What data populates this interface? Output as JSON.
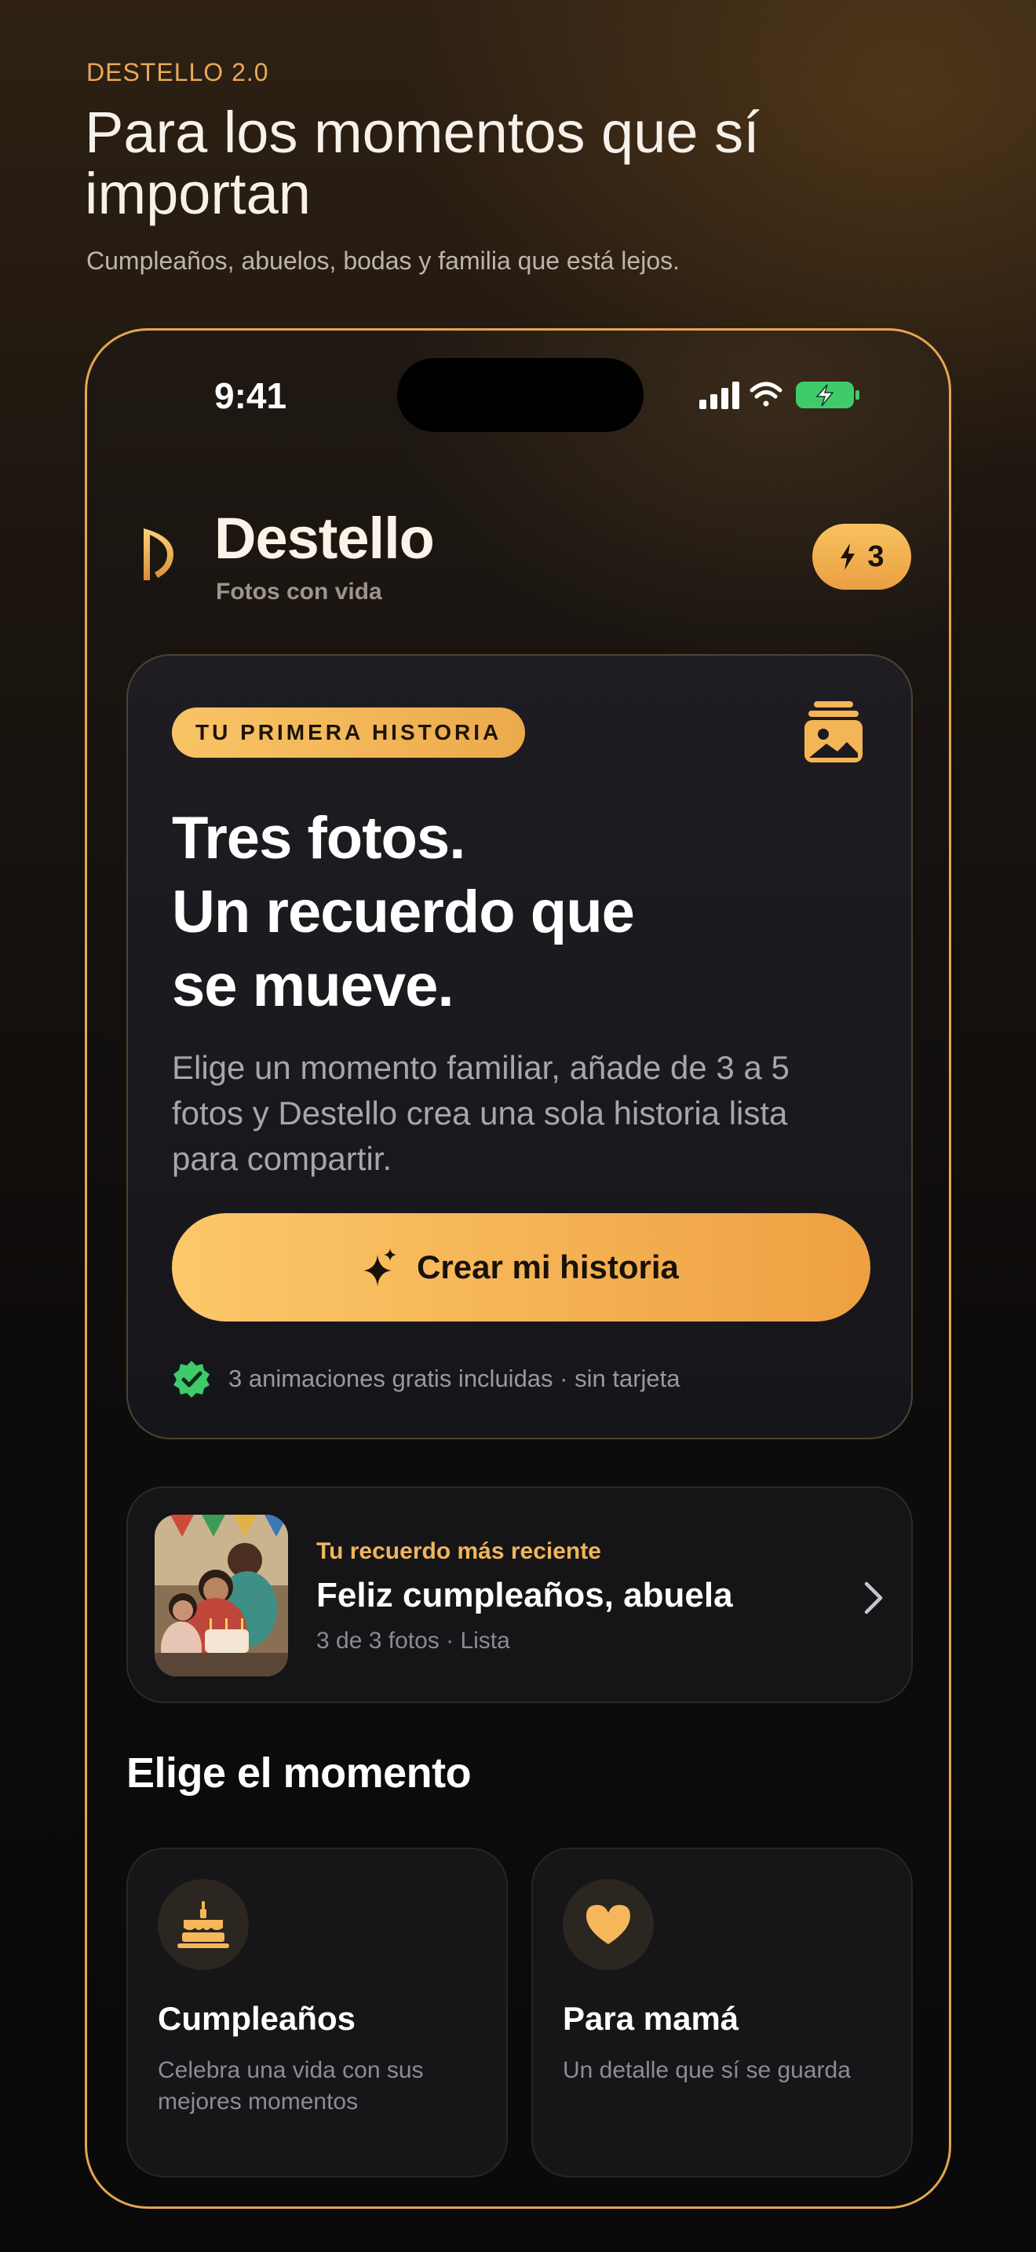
{
  "marketing": {
    "eyebrow": "DESTELLO 2.0",
    "headline": "Para los momentos que sí importan",
    "subline": "Cumpleaños, abuelos, bodas y familia que está lejos."
  },
  "status_bar": {
    "time": "9:41"
  },
  "app_header": {
    "title": "Destello",
    "subtitle": "Fotos con vida",
    "credits": "3"
  },
  "hero": {
    "badge": "TU PRIMERA HISTORIA",
    "title_lines": [
      "Tres fotos.",
      "Un recuerdo que",
      "se mueve."
    ],
    "body": "Elige un momento familiar, añade de 3 a 5 fotos y Destello crea una sola historia lista para compartir.",
    "cta": "Crear mi historia",
    "note": "3 animaciones gratis incluidas · sin tarjeta"
  },
  "recent": {
    "eyebrow": "Tu recuerdo más reciente",
    "title": "Feliz cumpleaños, abuela",
    "meta": "3 de 3 fotos · Lista"
  },
  "moments": {
    "section_title": "Elige el momento",
    "items": [
      {
        "icon": "birthday-cake-icon",
        "title": "Cumpleaños",
        "desc": "Celebra una vida con sus mejores momentos"
      },
      {
        "icon": "heart-icon",
        "title": "Para mamá",
        "desc": "Un detalle que sí se guarda"
      }
    ]
  },
  "colors": {
    "accent": "#F5B04E",
    "background": "#0A0A0B",
    "card": "#1A191E",
    "success": "#3FCB6A"
  }
}
